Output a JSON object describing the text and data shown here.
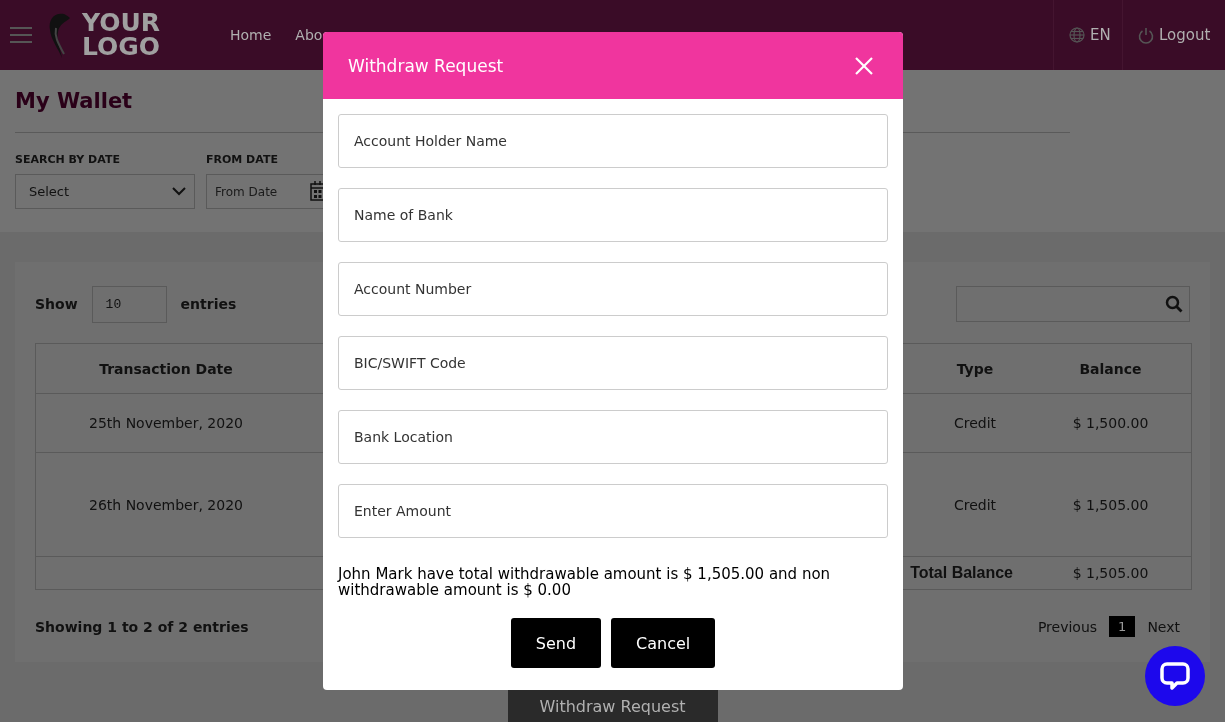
{
  "header": {
    "logo_lines": [
      "YOUR",
      "LOGO"
    ],
    "nav": [
      {
        "label": "Home"
      },
      {
        "label": "Abo"
      }
    ],
    "language": "EN",
    "logout": "Logout"
  },
  "page": {
    "title": "My Wallet",
    "filters": [
      {
        "kind": "select",
        "label": "SEARCH BY DATE",
        "value": "Select"
      },
      {
        "kind": "date",
        "label": "FROM DATE",
        "placeholder": "From Date"
      }
    ]
  },
  "table_section": {
    "show_label": "Show",
    "entries_value": "10",
    "entries_label": "entries",
    "columns": [
      "Transaction Date",
      "Type",
      "Balance"
    ],
    "rows": [
      {
        "date": "25th November, 2020",
        "type": "Credit",
        "balance": "$ 1,500.00",
        "tall": false
      },
      {
        "date": "26th November, 2020",
        "type": "Credit",
        "balance": "$ 1,505.00",
        "tall": true
      }
    ],
    "total_label": "Total Balance",
    "total_value": "$ 1,505.00",
    "info": "Showing 1 to 2 of 2 entries",
    "pagination": {
      "previous": "Previous",
      "pages": [
        {
          "label": "1",
          "selected": true
        }
      ],
      "next": "Next"
    }
  },
  "withdraw_button": "Withdraw Request",
  "modal": {
    "title": "Withdraw Request",
    "fields": [
      {
        "placeholder": "Account Holder Name"
      },
      {
        "placeholder": "Name of Bank"
      },
      {
        "placeholder": "Account Number"
      },
      {
        "placeholder": "BIC/SWIFT Code"
      },
      {
        "placeholder": "Bank Location"
      },
      {
        "placeholder": "Enter Amount"
      }
    ],
    "message": "John Mark have total withdrawable amount is $ 1,505.00 and non withdrawable amount is $ 0.00",
    "buttons": [
      "Send",
      "Cancel"
    ]
  }
}
